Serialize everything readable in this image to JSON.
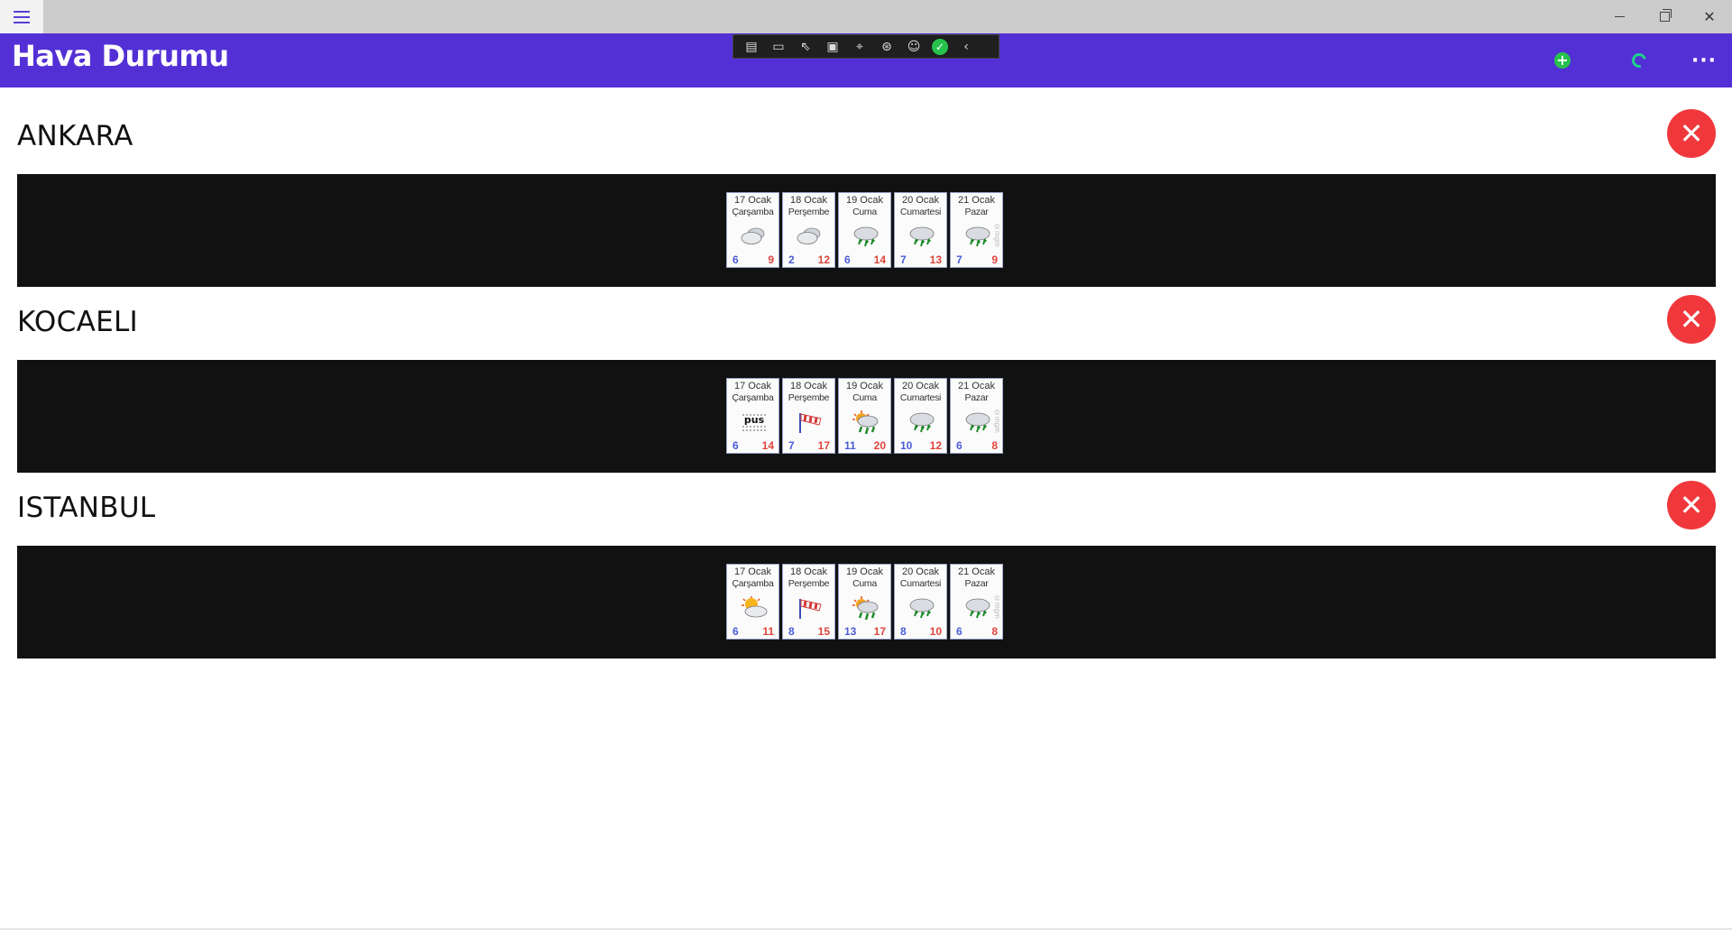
{
  "window": {
    "min_glyph": "—",
    "max_glyph": "",
    "close_glyph": "✕"
  },
  "header": {
    "title": "Hava Durumu",
    "add_icon": "plus-circle-icon",
    "refresh_icon": "refresh-icon",
    "more_glyph": "···"
  },
  "devtools": {
    "icons": [
      "live-visual-tree-icon",
      "video-icon",
      "select-element-icon",
      "display-layout-adorners-icon",
      "track-focus-icon",
      "binding-failures-icon",
      "accessibility-icon",
      "hot-reload-ok-icon",
      "collapse-icon"
    ],
    "collapse_glyph": "‹"
  },
  "colors": {
    "accent": "#5330d6",
    "remove": "#f0383c",
    "panel": "#111111",
    "low_temp": "#4a5cd6",
    "high_temp": "#e0443c"
  },
  "remove_glyph": "✕",
  "watermark": "©mgm",
  "cities": [
    {
      "name": "ANKARA",
      "days": [
        {
          "date": "17 Ocak",
          "day": "Çarşamba",
          "icon": "cloudy",
          "low": "6",
          "high": "9"
        },
        {
          "date": "18 Ocak",
          "day": "Perşembe",
          "icon": "cloudy",
          "low": "2",
          "high": "12"
        },
        {
          "date": "19 Ocak",
          "day": "Cuma",
          "icon": "rain",
          "low": "6",
          "high": "14"
        },
        {
          "date": "20 Ocak",
          "day": "Cumartesi",
          "icon": "rain",
          "low": "7",
          "high": "13"
        },
        {
          "date": "21 Ocak",
          "day": "Pazar",
          "icon": "rain",
          "low": "7",
          "high": "9"
        }
      ]
    },
    {
      "name": "KOCAELI",
      "days": [
        {
          "date": "17 Ocak",
          "day": "Çarşamba",
          "icon": "pus",
          "low": "6",
          "high": "14"
        },
        {
          "date": "18 Ocak",
          "day": "Perşembe",
          "icon": "wind",
          "low": "7",
          "high": "17"
        },
        {
          "date": "19 Ocak",
          "day": "Cuma",
          "icon": "sun-rain",
          "low": "11",
          "high": "20"
        },
        {
          "date": "20 Ocak",
          "day": "Cumartesi",
          "icon": "rain",
          "low": "10",
          "high": "12"
        },
        {
          "date": "21 Ocak",
          "day": "Pazar",
          "icon": "rain",
          "low": "6",
          "high": "8"
        }
      ]
    },
    {
      "name": "ISTANBUL",
      "days": [
        {
          "date": "17 Ocak",
          "day": "Çarşamba",
          "icon": "partly-sunny",
          "low": "6",
          "high": "11"
        },
        {
          "date": "18 Ocak",
          "day": "Perşembe",
          "icon": "wind",
          "low": "8",
          "high": "15"
        },
        {
          "date": "19 Ocak",
          "day": "Cuma",
          "icon": "sun-rain",
          "low": "13",
          "high": "17"
        },
        {
          "date": "20 Ocak",
          "day": "Cumartesi",
          "icon": "rain",
          "low": "8",
          "high": "10"
        },
        {
          "date": "21 Ocak",
          "day": "Pazar",
          "icon": "rain",
          "low": "6",
          "high": "8"
        }
      ]
    }
  ]
}
